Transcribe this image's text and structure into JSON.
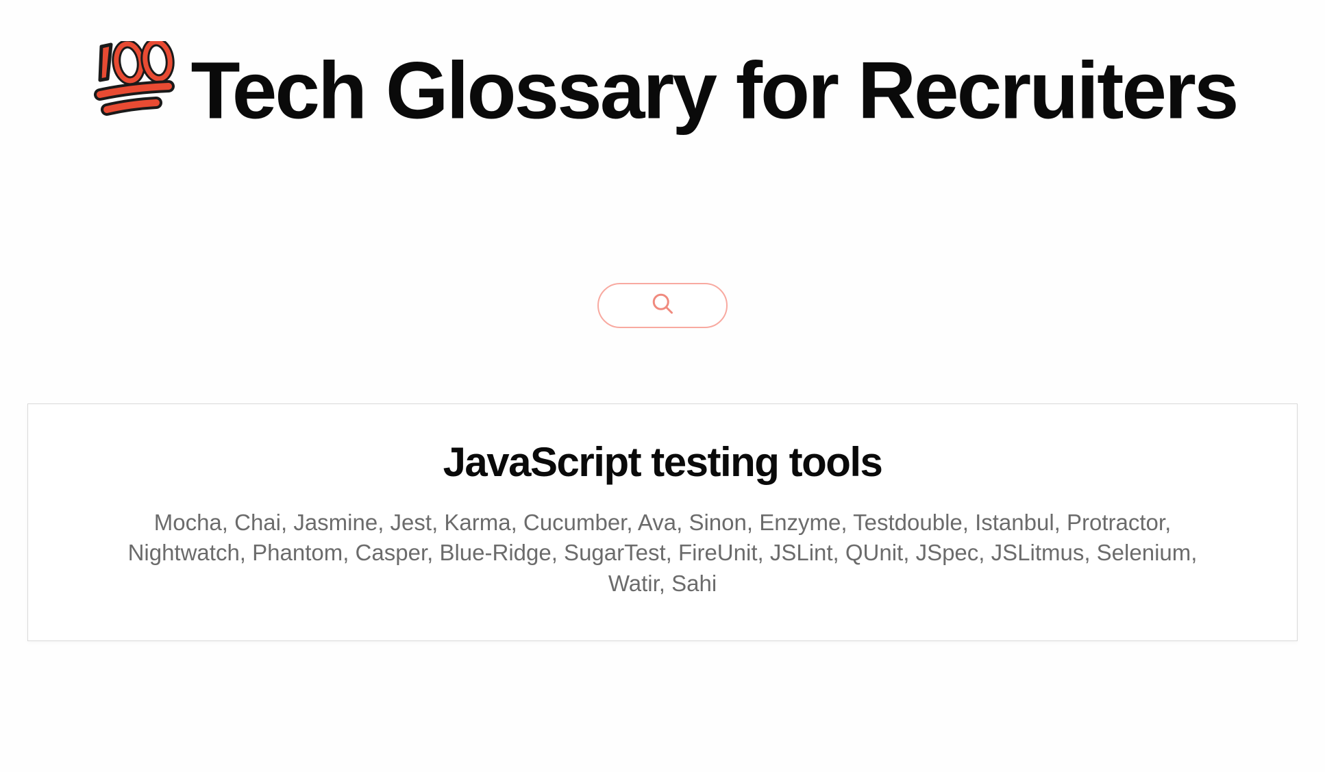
{
  "header": {
    "emoji": "💯",
    "title": "Tech Glossary for Recruiters"
  },
  "search": {
    "icon": "search-icon"
  },
  "card": {
    "title": "JavaScript testing tools",
    "body": "Mocha, Chai, Jasmine, Jest, Karma, Cucumber, Ava, Sinon, Enzyme, Testdouble, Istanbul, Protractor, Nightwatch, Phantom, Casper, Blue-Ridge, SugarTest, FireUnit, JSLint, QUnit, JSpec, JSLitmus, Selenium, Watir, Sahi"
  }
}
